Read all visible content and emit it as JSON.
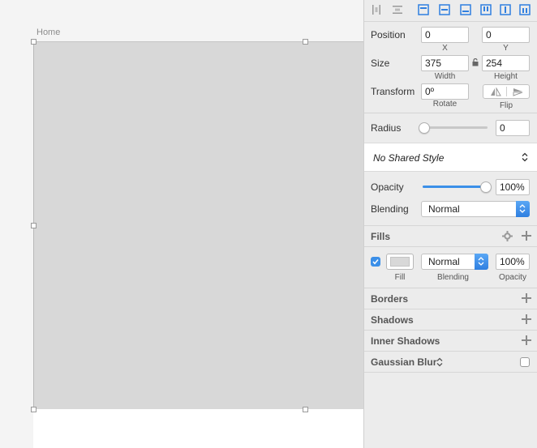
{
  "canvas": {
    "artboard_label": "Home"
  },
  "position": {
    "label": "Position",
    "x_value": "0",
    "x_label": "X",
    "y_value": "0",
    "y_label": "Y"
  },
  "size": {
    "label": "Size",
    "width_value": "375",
    "width_label": "Width",
    "height_value": "254",
    "height_label": "Height"
  },
  "transform": {
    "label": "Transform",
    "rotate_value": "0º",
    "rotate_label": "Rotate",
    "flip_label": "Flip"
  },
  "radius": {
    "label": "Radius",
    "value": "0",
    "slider_fraction": 0
  },
  "shared_style": {
    "label": "No Shared Style"
  },
  "opacity": {
    "label": "Opacity",
    "value": "100%",
    "slider_fraction": 1.0
  },
  "blending": {
    "label": "Blending",
    "value": "Normal"
  },
  "fills": {
    "title": "Fills",
    "enabled": true,
    "fill_color": "#d8d8d8",
    "blending_value": "Normal",
    "opacity_value": "100%",
    "fill_label": "Fill",
    "blending_label": "Blending",
    "opacity_label": "Opacity"
  },
  "borders": {
    "title": "Borders"
  },
  "shadows": {
    "title": "Shadows"
  },
  "inner_shadows": {
    "title": "Inner Shadows"
  },
  "gaussian_blur": {
    "title": "Gaussian Blur",
    "enabled": false
  },
  "colors": {
    "accent": "#3b8fe8",
    "panel": "#ececec",
    "shape_fill": "#d8d8d8"
  }
}
